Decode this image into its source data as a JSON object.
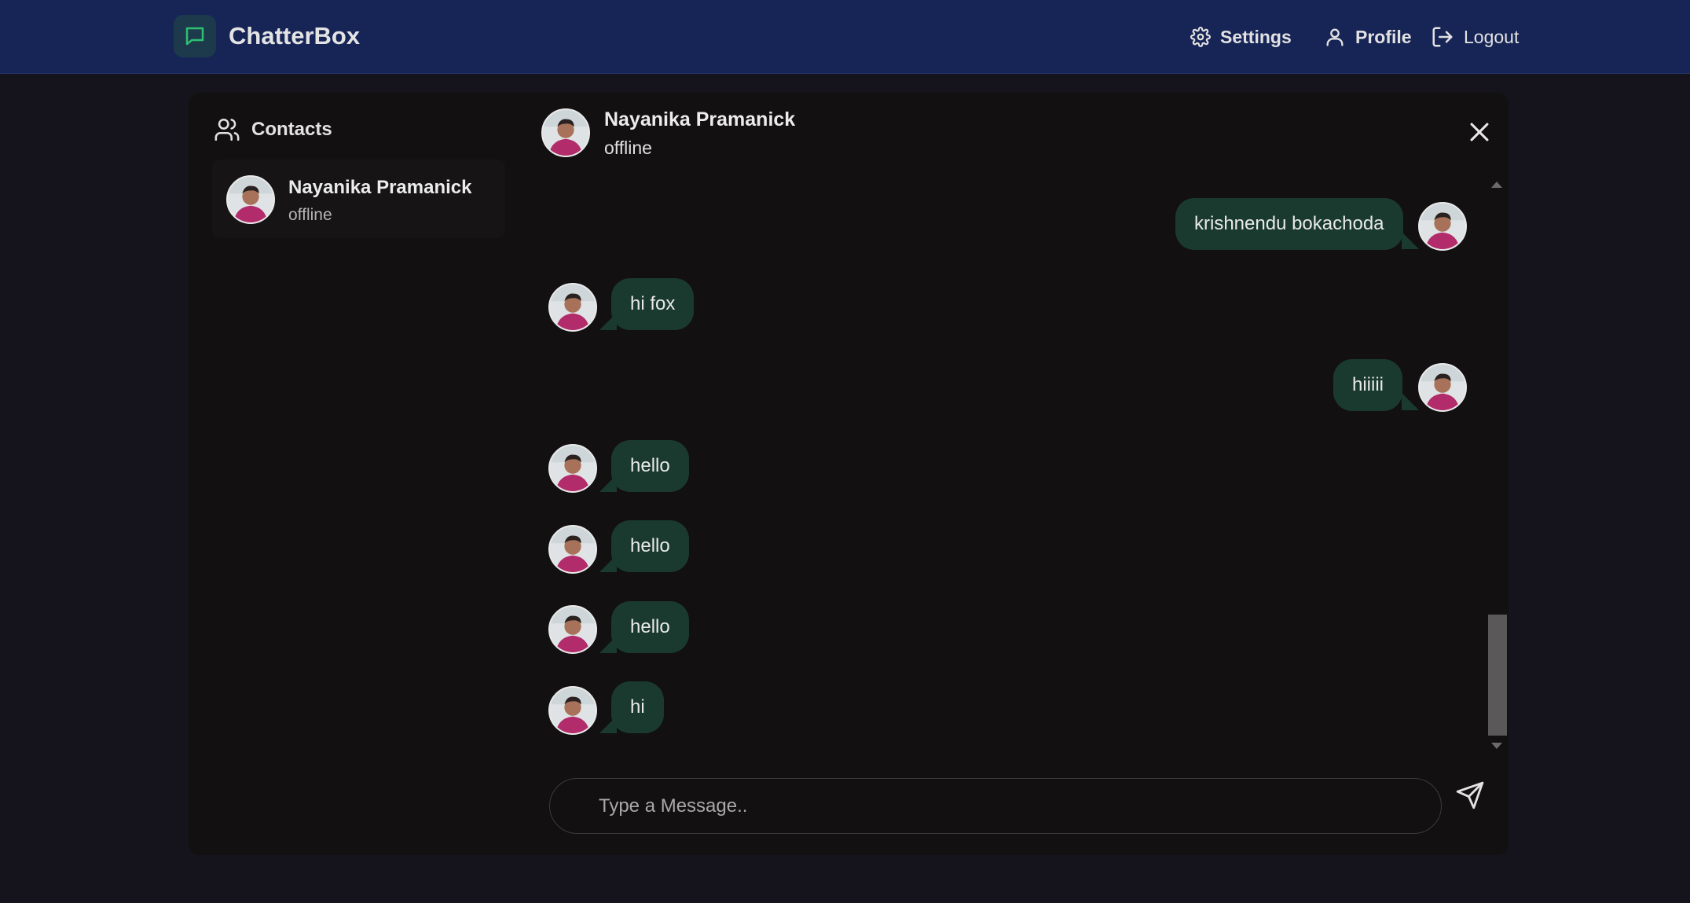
{
  "app": {
    "name": "ChatterBox"
  },
  "nav": {
    "settings": "Settings",
    "profile": "Profile",
    "logout": "Logout"
  },
  "sidebar": {
    "title": "Contacts",
    "contacts": [
      {
        "name": "Nayanika Pramanick",
        "status": "offline"
      }
    ]
  },
  "chat": {
    "name": "Nayanika Pramanick",
    "status": "offline",
    "messages": [
      {
        "text": "krishnendu bokachoda",
        "side": "sent"
      },
      {
        "text": "hi fox",
        "side": "received"
      },
      {
        "text": "hiiiii",
        "side": "sent"
      },
      {
        "text": "hello",
        "side": "received"
      },
      {
        "text": "hello",
        "side": "received"
      },
      {
        "text": "hello",
        "side": "received"
      },
      {
        "text": "hi",
        "side": "received"
      }
    ],
    "input_placeholder": "Type a Message.."
  },
  "colors": {
    "header": "#172556",
    "background": "#15141c",
    "panel": "#121010",
    "bubble": "#1a3a30",
    "brand_icon": "#2fbf71"
  }
}
